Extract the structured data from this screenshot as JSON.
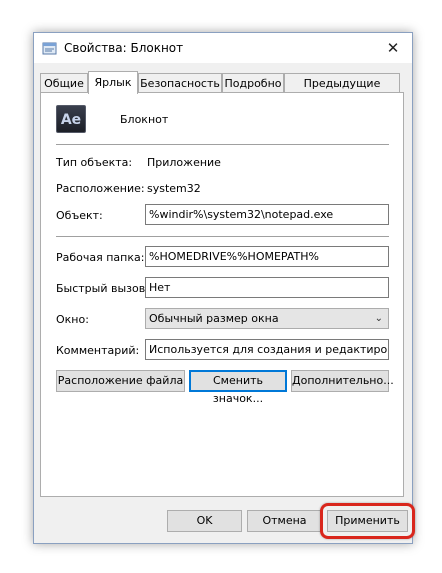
{
  "window": {
    "title": "Свойства: Блокнот",
    "close_glyph": "✕"
  },
  "tabs": [
    {
      "label": "Общие",
      "active": false
    },
    {
      "label": "Ярлык",
      "active": true
    },
    {
      "label": "Безопасность",
      "active": false
    },
    {
      "label": "Подробно",
      "active": false
    },
    {
      "label": "Предыдущие версии",
      "active": false
    }
  ],
  "shortcut": {
    "app_icon_text": "Ae",
    "app_name": "Блокнот",
    "type_label": "Тип объекта:",
    "type_value": "Приложение",
    "location_label": "Расположение:",
    "location_value": "system32",
    "target_label": "Объект:",
    "target_value": "%windir%\\system32\\notepad.exe",
    "start_in_label": "Рабочая папка:",
    "start_in_value": "%HOMEDRIVE%%HOMEPATH%",
    "hotkey_label": "Быстрый вызов:",
    "hotkey_value": "Нет",
    "run_label": "Окно:",
    "run_value": "Обычный размер окна",
    "comment_label": "Комментарий:",
    "comment_value": "Используется для создания и редактирования"
  },
  "buttons": {
    "open_location": "Расположение файла",
    "change_icon": "Сменить значок...",
    "advanced": "Дополнительно...",
    "ok": "OK",
    "cancel": "Отмена",
    "apply": "Применить"
  },
  "colors": {
    "highlight": "#d9261c",
    "focus": "#0078d7"
  }
}
